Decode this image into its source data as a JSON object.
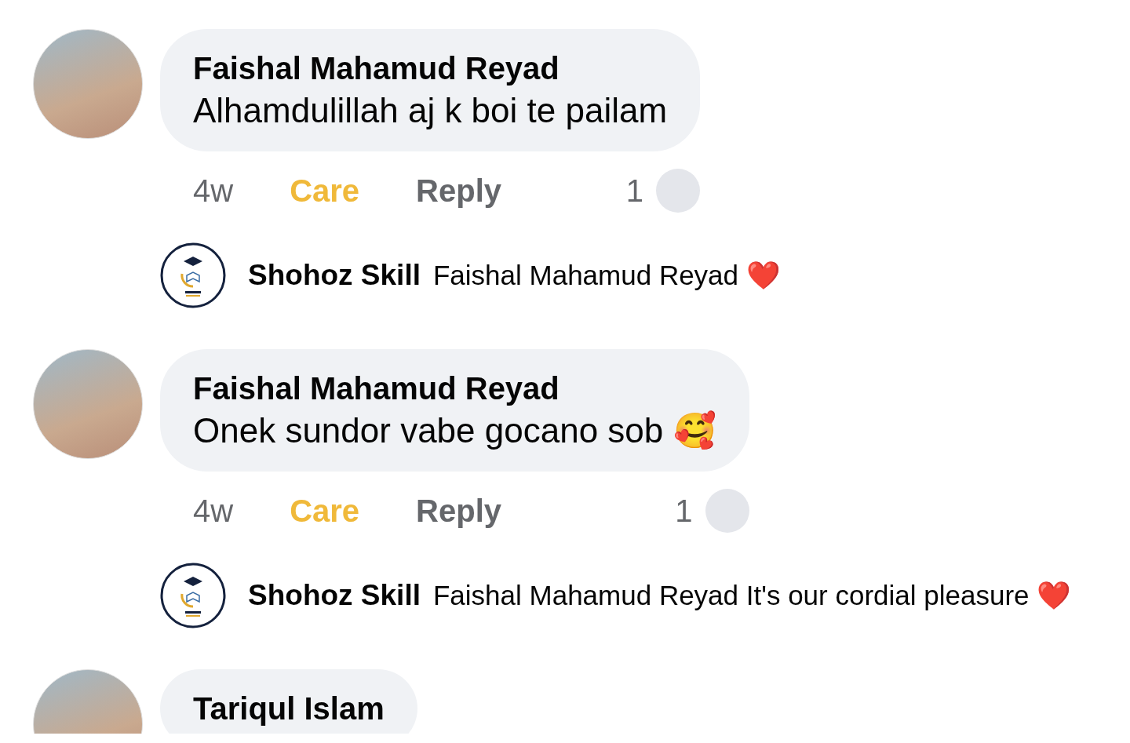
{
  "comments": [
    {
      "author": "Faishal Mahamud Reyad",
      "text": "Alhamdulillah aj k boi te pailam",
      "time": "4w",
      "reaction": "Care",
      "reacted": true,
      "reply_label": "Reply",
      "reaction_count": "1",
      "replies": [
        {
          "author": "Shohoz Skill",
          "text": "Faishal Mahamud Reyad ❤️"
        }
      ]
    },
    {
      "author": "Faishal Mahamud Reyad",
      "text": "Onek sundor vabe gocano sob 🥰",
      "time": "4w",
      "reaction": "Care",
      "reacted": true,
      "reply_label": "Reply",
      "reaction_count": "1",
      "replies": [
        {
          "author": "Shohoz Skill",
          "text": "Faishal Mahamud Reyad It's our cordial pleasure ❤️"
        }
      ]
    },
    {
      "author": "Tariqul Islam"
    }
  ]
}
